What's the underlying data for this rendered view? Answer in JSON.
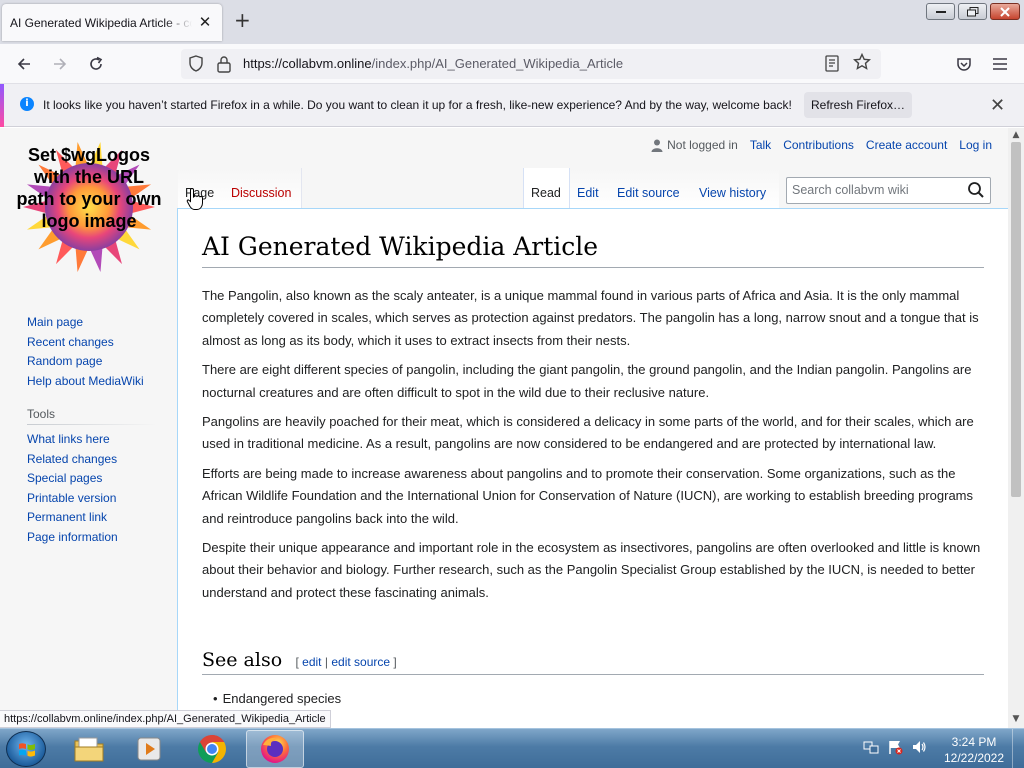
{
  "browser": {
    "tab_title": "AI Generated Wikipedia Article - coll",
    "tab_close": "✕",
    "new_tab": "+",
    "url_host": "https://collabvm.online",
    "url_path": "/index.php/AI_Generated_Wikipedia_Article",
    "status_url": "https://collabvm.online/index.php/AI_Generated_Wikipedia_Article"
  },
  "notification": {
    "icon": "i",
    "message": "It looks like you haven’t started Firefox in a while. Do you want to clean it up for a fresh, like-new experience? And by the way, welcome back!",
    "button": "Refresh Firefox…",
    "close": "✕"
  },
  "logo": {
    "text": "Set $wgLogos with the URL path to your own logo image"
  },
  "sidebar": {
    "navigation": [
      "Main page",
      "Recent changes",
      "Random page",
      "Help about MediaWiki"
    ],
    "tools_heading": "Tools",
    "tools": [
      "What links here",
      "Related changes",
      "Special pages",
      "Printable version",
      "Permanent link",
      "Page information"
    ]
  },
  "personal": {
    "not_logged_in": "Not logged in",
    "talk": "Talk",
    "contributions": "Contributions",
    "create_account": "Create account",
    "log_in": "Log in"
  },
  "tabs": {
    "page": "Page",
    "discussion": "Discussion",
    "read": "Read",
    "edit": "Edit",
    "edit_source": "Edit source",
    "view_history": "View history"
  },
  "search": {
    "placeholder": "Search collabvm wiki"
  },
  "article": {
    "title": "AI Generated Wikipedia Article",
    "paragraphs": [
      "The Pangolin, also known as the scaly anteater, is a unique mammal found in various parts of Africa and Asia. It is the only mammal completely covered in scales, which serves as protection against predators. The pangolin has a long, narrow snout and a tongue that is almost as long as its body, which it uses to extract insects from their nests.",
      "There are eight different species of pangolin, including the giant pangolin, the ground pangolin, and the Indian pangolin. Pangolins are nocturnal creatures and are often difficult to spot in the wild due to their reclusive nature.",
      "Pangolins are heavily poached for their meat, which is considered a delicacy in some parts of the world, and for their scales, which are used in traditional medicine. As a result, pangolins are now considered to be endangered and are protected by international law.",
      "Efforts are being made to increase awareness about pangolins and to promote their conservation. Some organizations, such as the African Wildlife Foundation and the International Union for Conservation of Nature (IUCN), are working to establish breeding programs and reintroduce pangolins back into the wild.",
      "Despite their unique appearance and important role in the ecosystem as insectivores, pangolins are often overlooked and little is known about their behavior and biology. Further research, such as the Pangolin Specialist Group established by the IUCN, is needed to better understand and protect these fascinating animals."
    ],
    "see_also": {
      "heading": "See also",
      "bracket_open": "[",
      "edit": "edit",
      "separator": "|",
      "edit_source": "edit source",
      "bracket_close": "]",
      "items": [
        "Endangered species"
      ]
    }
  },
  "taskbar": {
    "time": "3:24 PM",
    "date": "12/22/2022"
  },
  "colors": {
    "link": "#0645ad",
    "redlink": "#ba0000",
    "taskbar": "#4d7ba6"
  }
}
